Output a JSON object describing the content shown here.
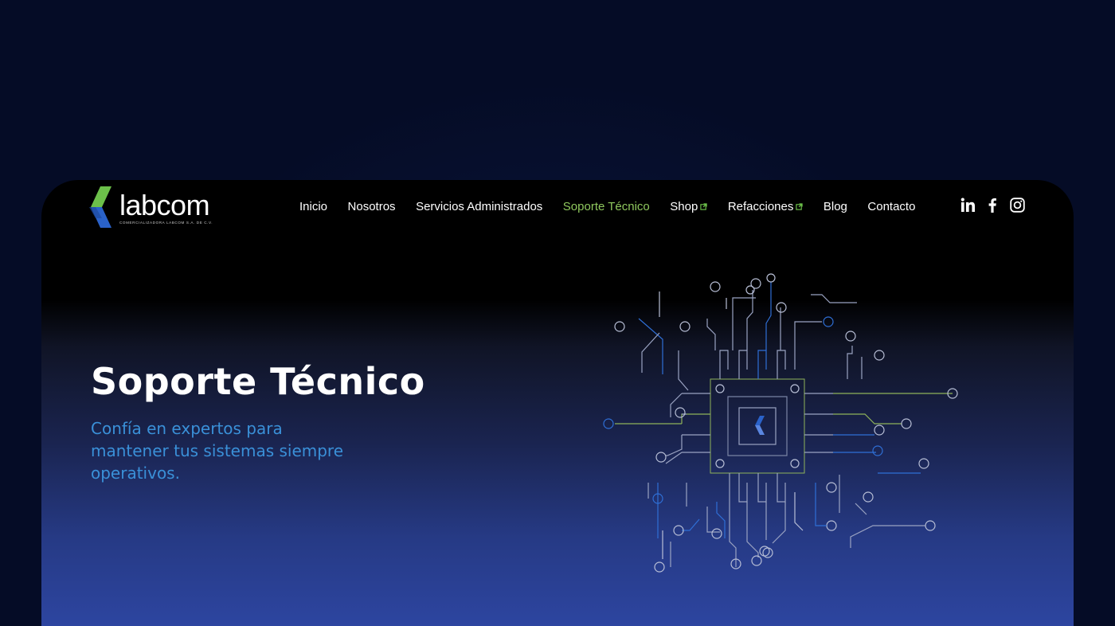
{
  "brand": {
    "name": "labcom",
    "tagline": "COMERCIALIZADORA LABCOM S.A. DE C.V.",
    "colors": {
      "green": "#6cc04a",
      "blue": "#2a62c9",
      "active_nav": "#8fc85e",
      "subtitle": "#3a90d8"
    }
  },
  "nav": {
    "items": [
      {
        "label": "Inicio",
        "active": false,
        "external": false
      },
      {
        "label": "Nosotros",
        "active": false,
        "external": false
      },
      {
        "label": "Servicios Administrados",
        "active": false,
        "external": false
      },
      {
        "label": "Soporte Técnico",
        "active": true,
        "external": false
      },
      {
        "label": "Shop",
        "active": false,
        "external": true
      },
      {
        "label": "Refacciones",
        "active": false,
        "external": true
      },
      {
        "label": "Blog",
        "active": false,
        "external": false
      },
      {
        "label": "Contacto",
        "active": false,
        "external": false
      }
    ],
    "social": [
      "linkedin-icon",
      "facebook-icon",
      "instagram-icon"
    ]
  },
  "hero": {
    "title": "Soporte Técnico",
    "subtitle": "Confía en expertos para mantener tus sistemas siempre operativos."
  },
  "illustration": {
    "icon": "circuit-chip-illustration"
  }
}
